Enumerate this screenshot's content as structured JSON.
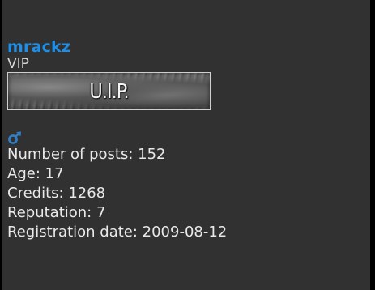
{
  "profile": {
    "username": "mrackz",
    "rank_title": "VIP",
    "rank_badge_text": "U.I.P.",
    "gender_icon": "male-symbol-icon",
    "stats": [
      {
        "label": "Number of posts:",
        "value": "152"
      },
      {
        "label": "Age:",
        "value": "17"
      },
      {
        "label": "Credits:",
        "value": "1268"
      },
      {
        "label": "Reputation:",
        "value": "7"
      },
      {
        "label": "Registration date:",
        "value": "2009-08-12"
      }
    ]
  },
  "colors": {
    "background": "#313131",
    "username": "#1e8ee6",
    "text": "#e9e9e9",
    "gender_icon": "#2f80c8"
  }
}
